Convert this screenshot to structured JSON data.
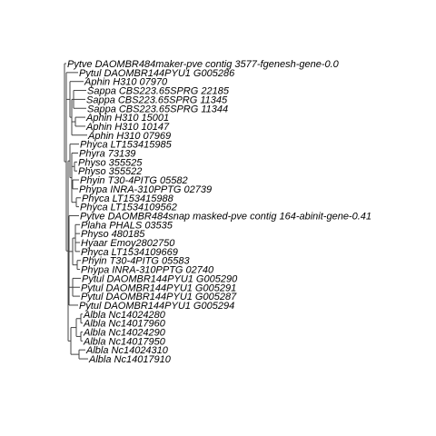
{
  "tree": {
    "leaves": [
      "Pytve DAOMBR484maker-pve contig 3577-fgenesh-gene-0.0",
      "Pytul DAOMBR144PYU1 G005286",
      "Aphin H310 07970",
      "Sappa CBS223.65SPRG 22185",
      "Sappa CBS223.65SPRG 11345",
      "Sappa CBS223.65SPRG 11344",
      "Aphin H310 15001",
      "Aphin H310 10147",
      "Aphin H310 07969",
      "Phyca LT153415985",
      "Phyra 73139",
      "Physo 355525",
      "Physo 355522",
      "Phyin T30-4PITG 05582",
      "Phypa INRA-310PPTG 02739",
      "Phyca LT153415988",
      "Phyca LT1534109562",
      "Pytve DAOMBR484snap masked-pve contig 164-abinit-gene-0.41",
      "Plaha PHALS 03535",
      "Physo 480185",
      "Hyaar Emoy2802750",
      "Phyca LT1534109669",
      "Phyin T30-4PITG 05583",
      "Phypa INRA-310PPTG 02740",
      "Pytul DAOMBR144PYU1 G005290",
      "Pytul DAOMBR144PYU1 G005291",
      "Pytul DAOMBR144PYU1 G005287",
      "Pytul DAOMBR144PYU1 G005294",
      "Albla Nc14024280",
      "Albla Nc14017960",
      "Albla Nc14024290",
      "Albla Nc14017950",
      "Albla Nc14024310",
      "Albla Nc14017910"
    ]
  }
}
